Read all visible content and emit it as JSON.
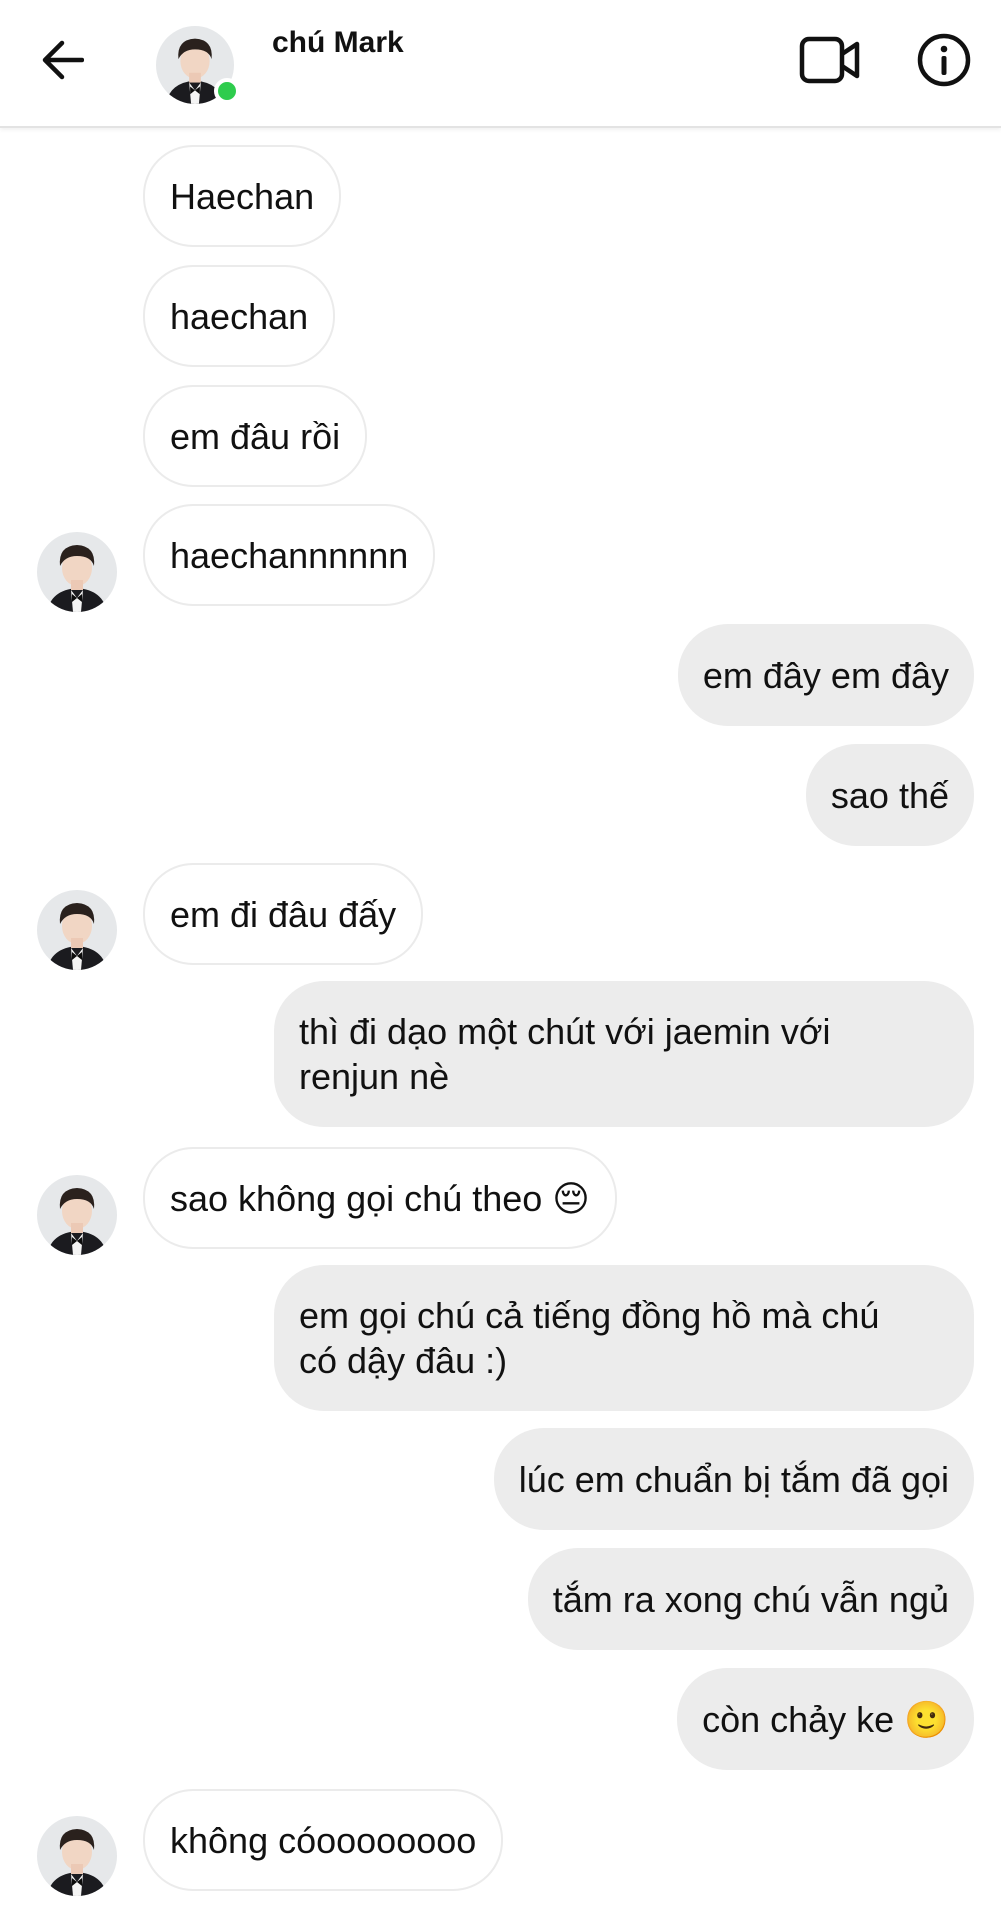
{
  "header": {
    "contact_name": "chú Mark",
    "back_icon": "arrow-left-icon",
    "video_icon": "video-camera-icon",
    "info_icon": "info-icon",
    "online_status_color": "#2ecc4d"
  },
  "messages": [
    {
      "sender": "contact",
      "text": "Haechan"
    },
    {
      "sender": "contact",
      "text": "haechan"
    },
    {
      "sender": "contact",
      "text": "em đâu rồi"
    },
    {
      "sender": "contact",
      "text": "haechannnnnn"
    },
    {
      "sender": "me",
      "text": "em đây em đây"
    },
    {
      "sender": "me",
      "text": "sao thế"
    },
    {
      "sender": "contact",
      "text": "em đi đâu đấy"
    },
    {
      "sender": "me",
      "text": "thì đi dạo một chút với jaemin với\nrenjun nè"
    },
    {
      "sender": "contact",
      "text": "sao không gọi chú theo 😔"
    },
    {
      "sender": "me",
      "text": "em gọi chú cả tiếng đồng hồ mà chú\ncó dậy đâu :)"
    },
    {
      "sender": "me",
      "text": "lúc em chuẩn bị tắm đã gọi"
    },
    {
      "sender": "me",
      "text": "tắm ra xong chú vẫn ngủ"
    },
    {
      "sender": "me",
      "text": "còn chảy ke 🙂"
    },
    {
      "sender": "contact",
      "text": "không cóoooooooo"
    }
  ],
  "colors": {
    "incoming_bubble": "#ffffff",
    "outgoing_bubble": "#ececec",
    "text": "#111111"
  }
}
